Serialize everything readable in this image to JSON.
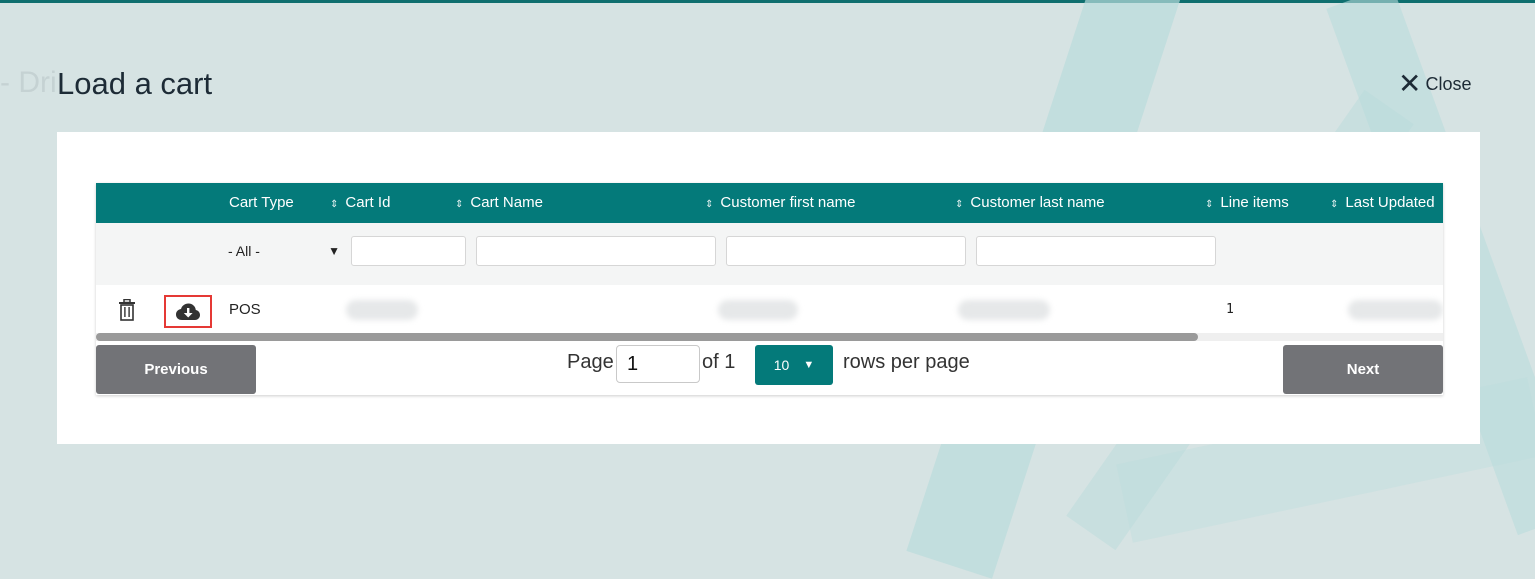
{
  "page": {
    "ghost_title": "- Dri"
  },
  "modal": {
    "title": "Load a cart",
    "close_label": "Close"
  },
  "table": {
    "headers": {
      "cart_type": "Cart Type",
      "cart_id": "Cart Id",
      "cart_name": "Cart Name",
      "first_name": "Customer first name",
      "last_name": "Customer last name",
      "line_items": "Line items",
      "last_updated": "Last Updated"
    },
    "filters": {
      "cart_type_selected": "- All -"
    },
    "rows": [
      {
        "cart_type": "POS",
        "line_items": "1"
      }
    ]
  },
  "pagination": {
    "previous_label": "Previous",
    "next_label": "Next",
    "page_label": "Page",
    "page_value": "1",
    "of_label": "of 1",
    "rows_value": "10",
    "rows_label": "rows per page"
  },
  "colors": {
    "accent": "#047a7a",
    "button": "#727377",
    "highlight": "#e53935"
  }
}
